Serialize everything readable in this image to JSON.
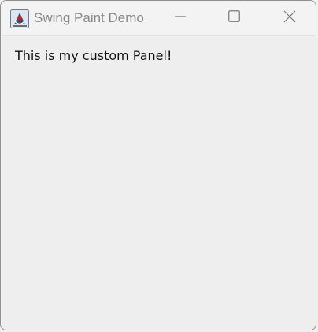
{
  "window": {
    "title": "Swing Paint Demo",
    "app_icon": "java-duke-icon",
    "controls": {
      "minimize_icon": "minimize-icon",
      "maximize_icon": "maximize-icon",
      "close_icon": "close-icon"
    }
  },
  "panel": {
    "text": "This is my custom Panel!"
  },
  "colors": {
    "background": "#eeeeee",
    "titlebar": "#f3f3f3",
    "title_text": "#888888",
    "body_text": "#111111"
  }
}
